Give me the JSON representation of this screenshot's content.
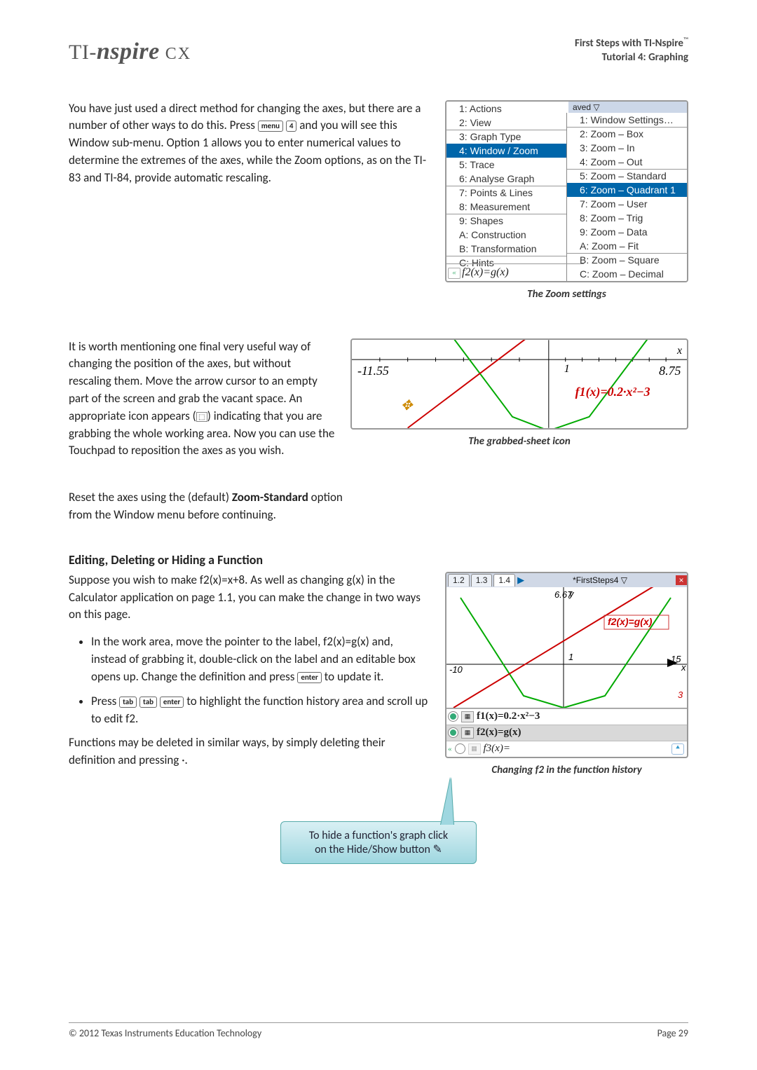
{
  "header": {
    "logo_pre": "TI-",
    "logo_main": "nspire",
    "logo_cx": " CX",
    "right_line1": "First Steps with TI-Nspire",
    "right_line2": "Tutorial 4: Graphing"
  },
  "para1": {
    "t1": "You have just used a direct method for changing the axes, but there are a number of other ways to do this. Press ",
    "key_menu": "menu",
    "key_4": "4",
    "t2": " and you will see this Window sub-menu. Option 1 allows you to enter numerical values to determine the extremes of the axes, while the Zoom options, as on the TI-83 and TI-84, provide automatic rescaling."
  },
  "fig1": {
    "caption": "The Zoom settings",
    "saved_label": "aved ▽",
    "left_menu": [
      "1: Actions",
      "2: View",
      "3: Graph Type",
      "4: Window / Zoom",
      "5: Trace",
      "6: Analyse Graph",
      "7: Points & Lines",
      "8: Measurement",
      "9: Shapes",
      "A: Construction",
      "B: Transformation",
      "C: Hints"
    ],
    "f2_label": "f2(x)=g(x)",
    "sub_menu": [
      "1: Window Settings…",
      "2: Zoom – Box",
      "3: Zoom – In",
      "4: Zoom – Out",
      "5: Zoom – Standard",
      "6: Zoom – Quadrant 1",
      "7: Zoom – User",
      "8: Zoom – Trig",
      "9: Zoom – Data",
      "A: Zoom – Fit",
      "B: Zoom – Square",
      "C: Zoom – Decimal"
    ]
  },
  "para2": {
    "t1": "It is worth mentioning one final very useful way of changing the position of the axes, but without rescaling them. Move the arrow cursor to an empty part of the screen and grab the vacant space. An appropriate icon appears (",
    "icon_text": "⬚",
    "t2": ") indicating that you are grabbing the whole working area. Now you can use the Touchpad to reposition the axes as you wish."
  },
  "fig2": {
    "caption": "The grabbed-sheet icon",
    "xmin": "-11.55",
    "xmax": "8.75",
    "one": "1",
    "eq": "f1(x)=0.2·x²−3",
    "x": "x"
  },
  "para3": {
    "t1": "Reset the axes using the (default) ",
    "bold": "Zoom-Standard",
    "t2": " option from the Window menu before continuing."
  },
  "section_heading": "Editing, Deleting or Hiding a Function",
  "para4": "Suppose you wish to make f2(x)=x+8. As well as changing g(x) in the Calculator application on page 1.1, you can make the change in two ways on this page.",
  "bullet1": {
    "t1": "In the work area, move the pointer to the label, f2(x)=g(x) and, instead of grabbing it, double-click on the label and an editable box opens up.  Change the definition and press ",
    "k": "enter",
    "t2": " to update it."
  },
  "bullet2": {
    "t1": "Press ",
    "k1": "tab",
    "k2": "tab",
    "k3": "enter",
    "t2": " to highlight the function history area and scroll up to edit f2."
  },
  "para5": "Functions may be deleted in similar ways, by simply deleting their definition and pressing ·.",
  "fig3": {
    "caption": "Changing f2 in the function history",
    "tabs": [
      "1.2",
      "1.3",
      "1.4"
    ],
    "title": "*FirstSteps4 ▽",
    "ytop": "6.67",
    "y": "y",
    "one": "1",
    "xmin": "-10",
    "xmax": "15",
    "eq_red": "f2(x)=g(x)",
    "three": "3",
    "x": "x",
    "rows": [
      {
        "label": "f1(x)=0.2·x²−3",
        "on": true,
        "bold": true
      },
      {
        "label": "f2(x)=g(x)",
        "on": true,
        "bold": true,
        "sel": true
      },
      {
        "label": "f3(x)=",
        "on": false,
        "bold": false
      }
    ]
  },
  "callout": {
    "line1": "To hide a function's graph click",
    "line2": "on the Hide/Show button ✎"
  },
  "footer": {
    "left": "© 2012 Texas Instruments Education Technology",
    "right": "Page  29"
  }
}
